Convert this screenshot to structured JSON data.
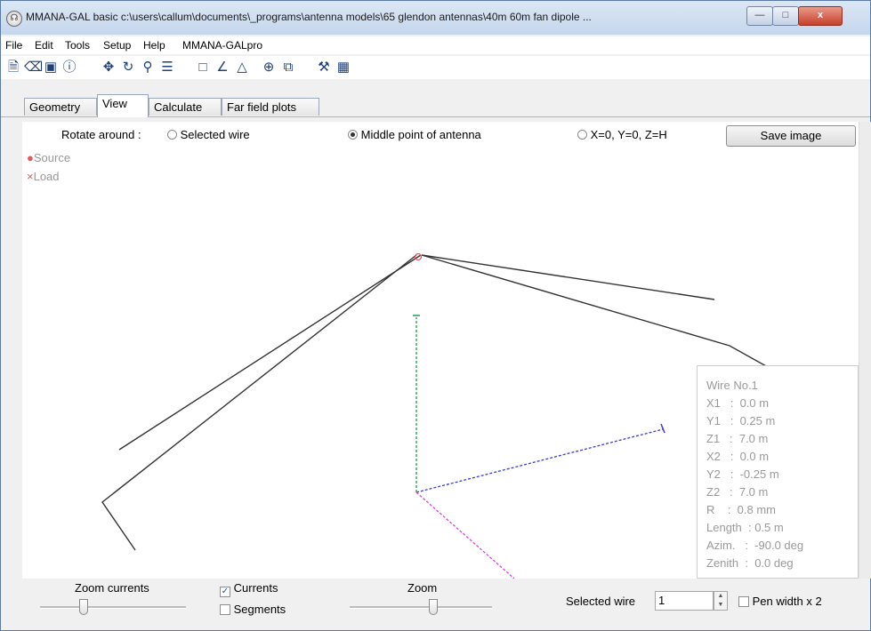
{
  "window": {
    "title": "MMANA-GAL basic c:\\users\\callum\\documents\\_programs\\antenna models\\65 glendon antennas\\40m 60m fan dipole ...",
    "min_glyph": "—",
    "max_glyph": "□",
    "close_glyph": "x"
  },
  "menu": [
    "File",
    "Edit",
    "Tools",
    "Setup",
    "Help",
    "MMANA-GALpro"
  ],
  "tabs": [
    "Geometry",
    "View",
    "Calculate",
    "Far field plots"
  ],
  "active_tab": "View",
  "rotate": {
    "label": "Rotate around :",
    "options": [
      "Selected wire",
      "Middle point of antenna",
      "X=0, Y=0, Z=H"
    ],
    "selected": "Middle point of antenna"
  },
  "save_image_label": "Save image",
  "legend": {
    "source": "Source",
    "load": "Load",
    "source_color": "#e05a5a",
    "load_color": "#e05a5a"
  },
  "wire_info": [
    "Wire No.1",
    "X1   :  0.0 m",
    "Y1   :  0.25 m",
    "Z1   :  7.0 m",
    "X2   :  0.0 m",
    "Y2   :  -0.25 m",
    "Z2   :  7.0 m",
    "R    :  0.8 mm",
    "Length  : 0.5 m",
    "Azim.   :  -90.0 deg",
    "Zenith  :  0.0 deg"
  ],
  "bottom": {
    "zoom_currents_label": "Zoom currents",
    "currents_label": "Currents",
    "currents_checked": true,
    "segments_label": "Segments",
    "segments_checked": false,
    "zoom_label": "Zoom",
    "selected_wire_label": "Selected wire",
    "selected_wire_value": "1",
    "pen_width_label": "Pen width x 2",
    "pen_width_checked": false
  },
  "colors": {
    "wire": "#333333",
    "axis_x": "#3a3ae0",
    "axis_y": "#e040e0",
    "axis_z": "#20a040",
    "source": "#e05a5a"
  }
}
